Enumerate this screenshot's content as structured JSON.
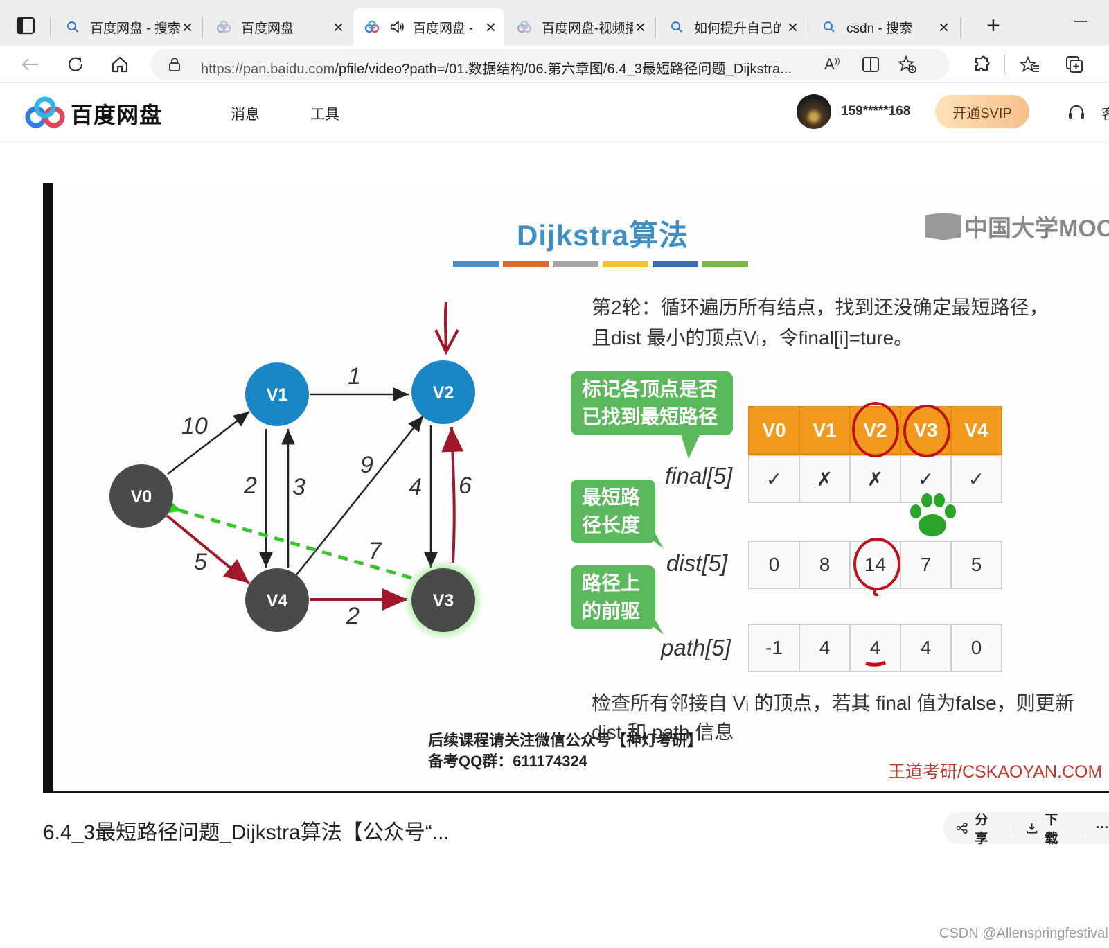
{
  "browser": {
    "tabs": [
      {
        "label": "百度网盘 - 搜索",
        "icon": "search-icon"
      },
      {
        "label": "百度网盘",
        "icon": "baidu-cloud-icon"
      },
      {
        "label": "百度网盘 -",
        "icon": "baidu-cloud-icon",
        "active": true
      },
      {
        "label": "百度网盘-视频播",
        "icon": "baidu-cloud-icon"
      },
      {
        "label": "如何提升自己的",
        "icon": "search-icon"
      },
      {
        "label": "csdn - 搜索",
        "icon": "search-icon"
      }
    ],
    "url_host": "https://pan.baidu.com",
    "url_path": "/pfile/video?path=/01.数据结构/06.第六章图/6.4_3最短路径问题_Dijkstra..."
  },
  "header": {
    "brand": "百度网盘",
    "nav": [
      "消息",
      "工具"
    ],
    "username": "159*****168",
    "svip_label": "开通SVIP",
    "cut_text": "客"
  },
  "slide": {
    "title": "Dijkstra算法",
    "mooc": "中国大学MOOC",
    "color_bars": [
      "#4e8ec4",
      "#d9692c",
      "#a6a6a6",
      "#f2c12e",
      "#3a6db0",
      "#7ab648"
    ],
    "desc1": "第2轮：循环遍历所有结点，找到还没确定最短路径，且dist 最小的顶点Vᵢ，令final[i]=ture。",
    "bubble_final": "标记各顶点是否已找到最短路径",
    "bubble_dist": "最短路径长度",
    "bubble_path": "路径上的前驱",
    "headers": [
      "V0",
      "V1",
      "V2",
      "V3",
      "V4"
    ],
    "final_label": "final[5]",
    "final": [
      "✓",
      "✗",
      "✗",
      "✓",
      "✓"
    ],
    "dist_label": "dist[5]",
    "dist": [
      "0",
      "8",
      "14",
      "7",
      "5"
    ],
    "path_label": "path[5]",
    "path": [
      "-1",
      "4",
      "4",
      "4",
      "0"
    ],
    "desc2": "检查所有邻接自 Vᵢ 的顶点，若其 final 值为false，则更新 dist 和 path 信息",
    "notice_line1": "后续课程请关注微信公众号【神灯考研】",
    "notice_line2": "备考QQ群：611174324",
    "credit": "王道考研/CSKAOYAN.COM",
    "graph": {
      "nodes": [
        "V0",
        "V1",
        "V2",
        "V3",
        "V4"
      ],
      "edges": [
        {
          "from": "V0",
          "to": "V1",
          "weight": "10"
        },
        {
          "from": "V1",
          "to": "V2",
          "weight": "1"
        },
        {
          "from": "V1",
          "to": "V4",
          "weight": "2"
        },
        {
          "from": "V4",
          "to": "V1",
          "weight": "3"
        },
        {
          "from": "V4",
          "to": "V2",
          "weight": "9"
        },
        {
          "from": "V2",
          "to": "V3",
          "weight": "4"
        },
        {
          "from": "V3",
          "to": "V2",
          "weight": "6"
        },
        {
          "from": "V3",
          "to": "V0",
          "weight": "7"
        },
        {
          "from": "V0",
          "to": "V4",
          "weight": "5"
        },
        {
          "from": "V4",
          "to": "V3",
          "weight": "2"
        }
      ]
    }
  },
  "video": {
    "title": "6.4_3最短路径问题_Dijkstra算法【公众号“...",
    "share_label": "分享",
    "download_label": "下载",
    "more_label": "···"
  },
  "watermark": "CSDN @Allenspringfestival",
  "colors": {
    "accent_blue": "#3f8fc4",
    "node_blue": "#1a86c5",
    "node_gray": "#4a4a4a",
    "header_orange": "#f29a1d",
    "bubble_green": "#5cb85c",
    "red": "#c0392b"
  }
}
